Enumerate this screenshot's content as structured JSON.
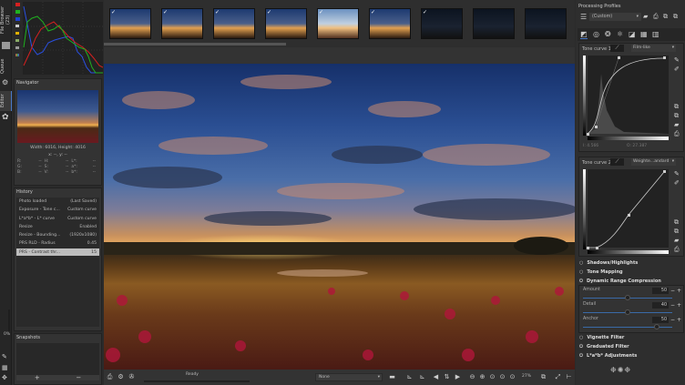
{
  "vertical_tabs": [
    "File Browser (23)",
    "Queue",
    "Editor"
  ],
  "histogram": {
    "buttons": [
      "red",
      "green",
      "blue",
      "luminance",
      "chroma",
      "raw",
      "bar",
      "mode"
    ],
    "colors": {
      "red": "#d42020",
      "green": "#20b020",
      "blue": "#2040d0"
    }
  },
  "navigator": {
    "title": "Navigator",
    "size": "Width: 6016, Height: 4016",
    "coords": "x: --, y: --",
    "rows": [
      [
        "R:",
        "--",
        "H:",
        "--",
        "L*:",
        "--"
      ],
      [
        "G:",
        "--",
        "S:",
        "--",
        "a*:",
        "--"
      ],
      [
        "B:",
        "--",
        "V:",
        "--",
        "b*:",
        "--"
      ]
    ]
  },
  "history": {
    "title": "History",
    "items": [
      {
        "label": "Photo loaded",
        "value": "(Last Saved)"
      },
      {
        "label": "Exposure - Tone c...",
        "value": "Custom curve"
      },
      {
        "label": "L*a*b* - L* curve",
        "value": "Custom curve"
      },
      {
        "label": "Resize",
        "value": "Enabled"
      },
      {
        "label": "Resize - Bounding...",
        "value": "(1920x1080)"
      },
      {
        "label": "PRS RLD - Radius",
        "value": "0.45"
      },
      {
        "label": "PRS - Contrast thr...",
        "value": "15",
        "selected": true
      }
    ]
  },
  "snapshots": {
    "title": "Snapshots",
    "add": "+",
    "remove": "−"
  },
  "zoom_side": "0%",
  "status": {
    "text": "Ready",
    "profile_select": "None",
    "zoom": "27%"
  },
  "right": {
    "profiles_title": "Processing Profiles",
    "profile": "(Custom)",
    "tone_curve1": {
      "label": "Tone curve 1:",
      "type": "Film-like",
      "i_label": "I:",
      "i_value": "4.566",
      "o_label": "O:",
      "o_value": "27.387"
    },
    "tone_curve2": {
      "label": "Tone curve 2:",
      "type": "Weighte...andard"
    },
    "tools": [
      {
        "label": "Shadows/Highlights",
        "icon": "circle"
      },
      {
        "label": "Tone Mapping",
        "icon": "circle"
      },
      {
        "label": "Dynamic Range Compression",
        "icon": "power"
      }
    ],
    "drc": [
      {
        "label": "Amount",
        "value": "50",
        "fraction": 0.5
      },
      {
        "label": "Detail",
        "value": "40",
        "fraction": 0.5
      },
      {
        "label": "Anchor",
        "value": "50",
        "fraction": 0.85
      }
    ],
    "tools2": [
      {
        "label": "Vignette Filter",
        "icon": "circle"
      },
      {
        "label": "Graduated Filter",
        "icon": "power"
      },
      {
        "label": "L*a*b* Adjustments",
        "icon": "power"
      }
    ]
  }
}
